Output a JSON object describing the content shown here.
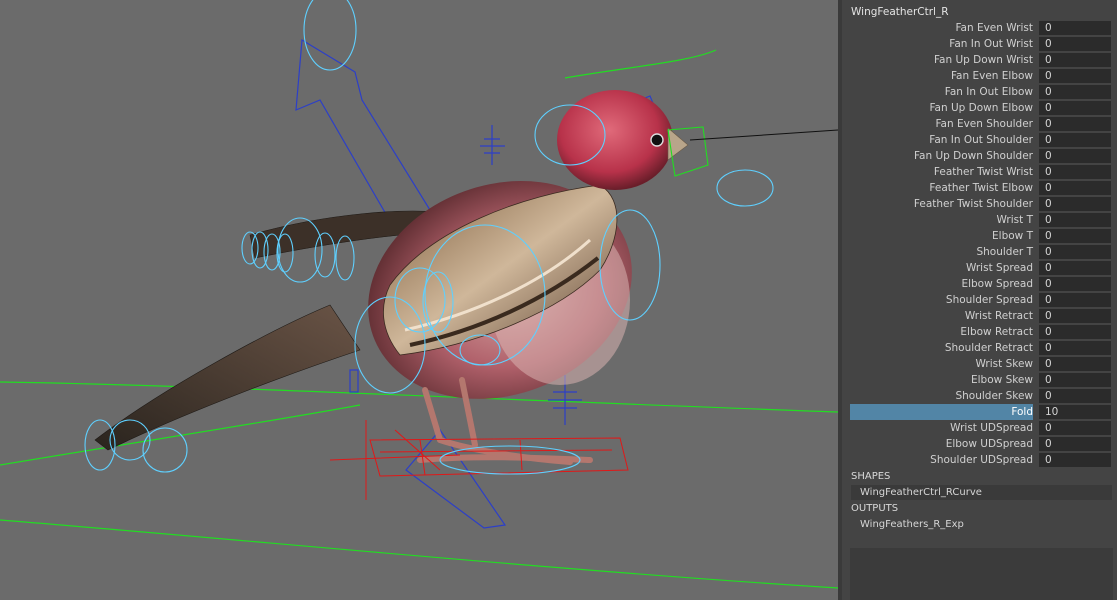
{
  "node_name": "WingFeatherCtrl_R",
  "attributes": [
    {
      "label": "Fan Even Wrist",
      "value": "0"
    },
    {
      "label": "Fan In Out Wrist",
      "value": "0"
    },
    {
      "label": "Fan Up Down Wrist",
      "value": "0"
    },
    {
      "label": "Fan Even Elbow",
      "value": "0"
    },
    {
      "label": "Fan In Out Elbow",
      "value": "0"
    },
    {
      "label": "Fan Up Down Elbow",
      "value": "0"
    },
    {
      "label": "Fan Even Shoulder",
      "value": "0"
    },
    {
      "label": "Fan In Out Shoulder",
      "value": "0"
    },
    {
      "label": "Fan Up Down Shoulder",
      "value": "0"
    },
    {
      "label": "Feather Twist Wrist",
      "value": "0"
    },
    {
      "label": "Feather Twist Elbow",
      "value": "0"
    },
    {
      "label": "Feather Twist Shoulder",
      "value": "0"
    },
    {
      "label": "Wrist T",
      "value": "0"
    },
    {
      "label": "Elbow T",
      "value": "0"
    },
    {
      "label": "Shoulder T",
      "value": "0"
    },
    {
      "label": "Wrist Spread",
      "value": "0"
    },
    {
      "label": "Elbow Spread",
      "value": "0"
    },
    {
      "label": "Shoulder Spread",
      "value": "0"
    },
    {
      "label": "Wrist Retract",
      "value": "0"
    },
    {
      "label": "Elbow Retract",
      "value": "0"
    },
    {
      "label": "Shoulder Retract",
      "value": "0"
    },
    {
      "label": "Wrist Skew",
      "value": "0"
    },
    {
      "label": "Elbow Skew",
      "value": "0"
    },
    {
      "label": "Shoulder Skew",
      "value": "0"
    },
    {
      "label": "Fold",
      "value": "10",
      "selected": true
    },
    {
      "label": "Wrist UDSpread",
      "value": "0"
    },
    {
      "label": "Elbow UDSpread",
      "value": "0"
    },
    {
      "label": "Shoulder UDSpread",
      "value": "0"
    }
  ],
  "shapes": {
    "heading": "SHAPES",
    "items": [
      "WingFeatherCtrl_RCurve"
    ]
  },
  "outputs": {
    "heading": "OUTPUTS",
    "items": [
      "WingFeathers_R_Exp"
    ]
  },
  "colors": {
    "viewport_bg": "#6b6b6b",
    "panel_bg": "#444444",
    "field_bg": "#2b2b2b",
    "selection": "#5285a6",
    "ctrl_cyan": "#5fd0ff",
    "ctrl_blue": "#2c3fc8",
    "ctrl_red": "#e01818",
    "ctrl_green": "#22dd22"
  },
  "icons": {
    "viewport": "bird-rig-3d-viewport"
  }
}
